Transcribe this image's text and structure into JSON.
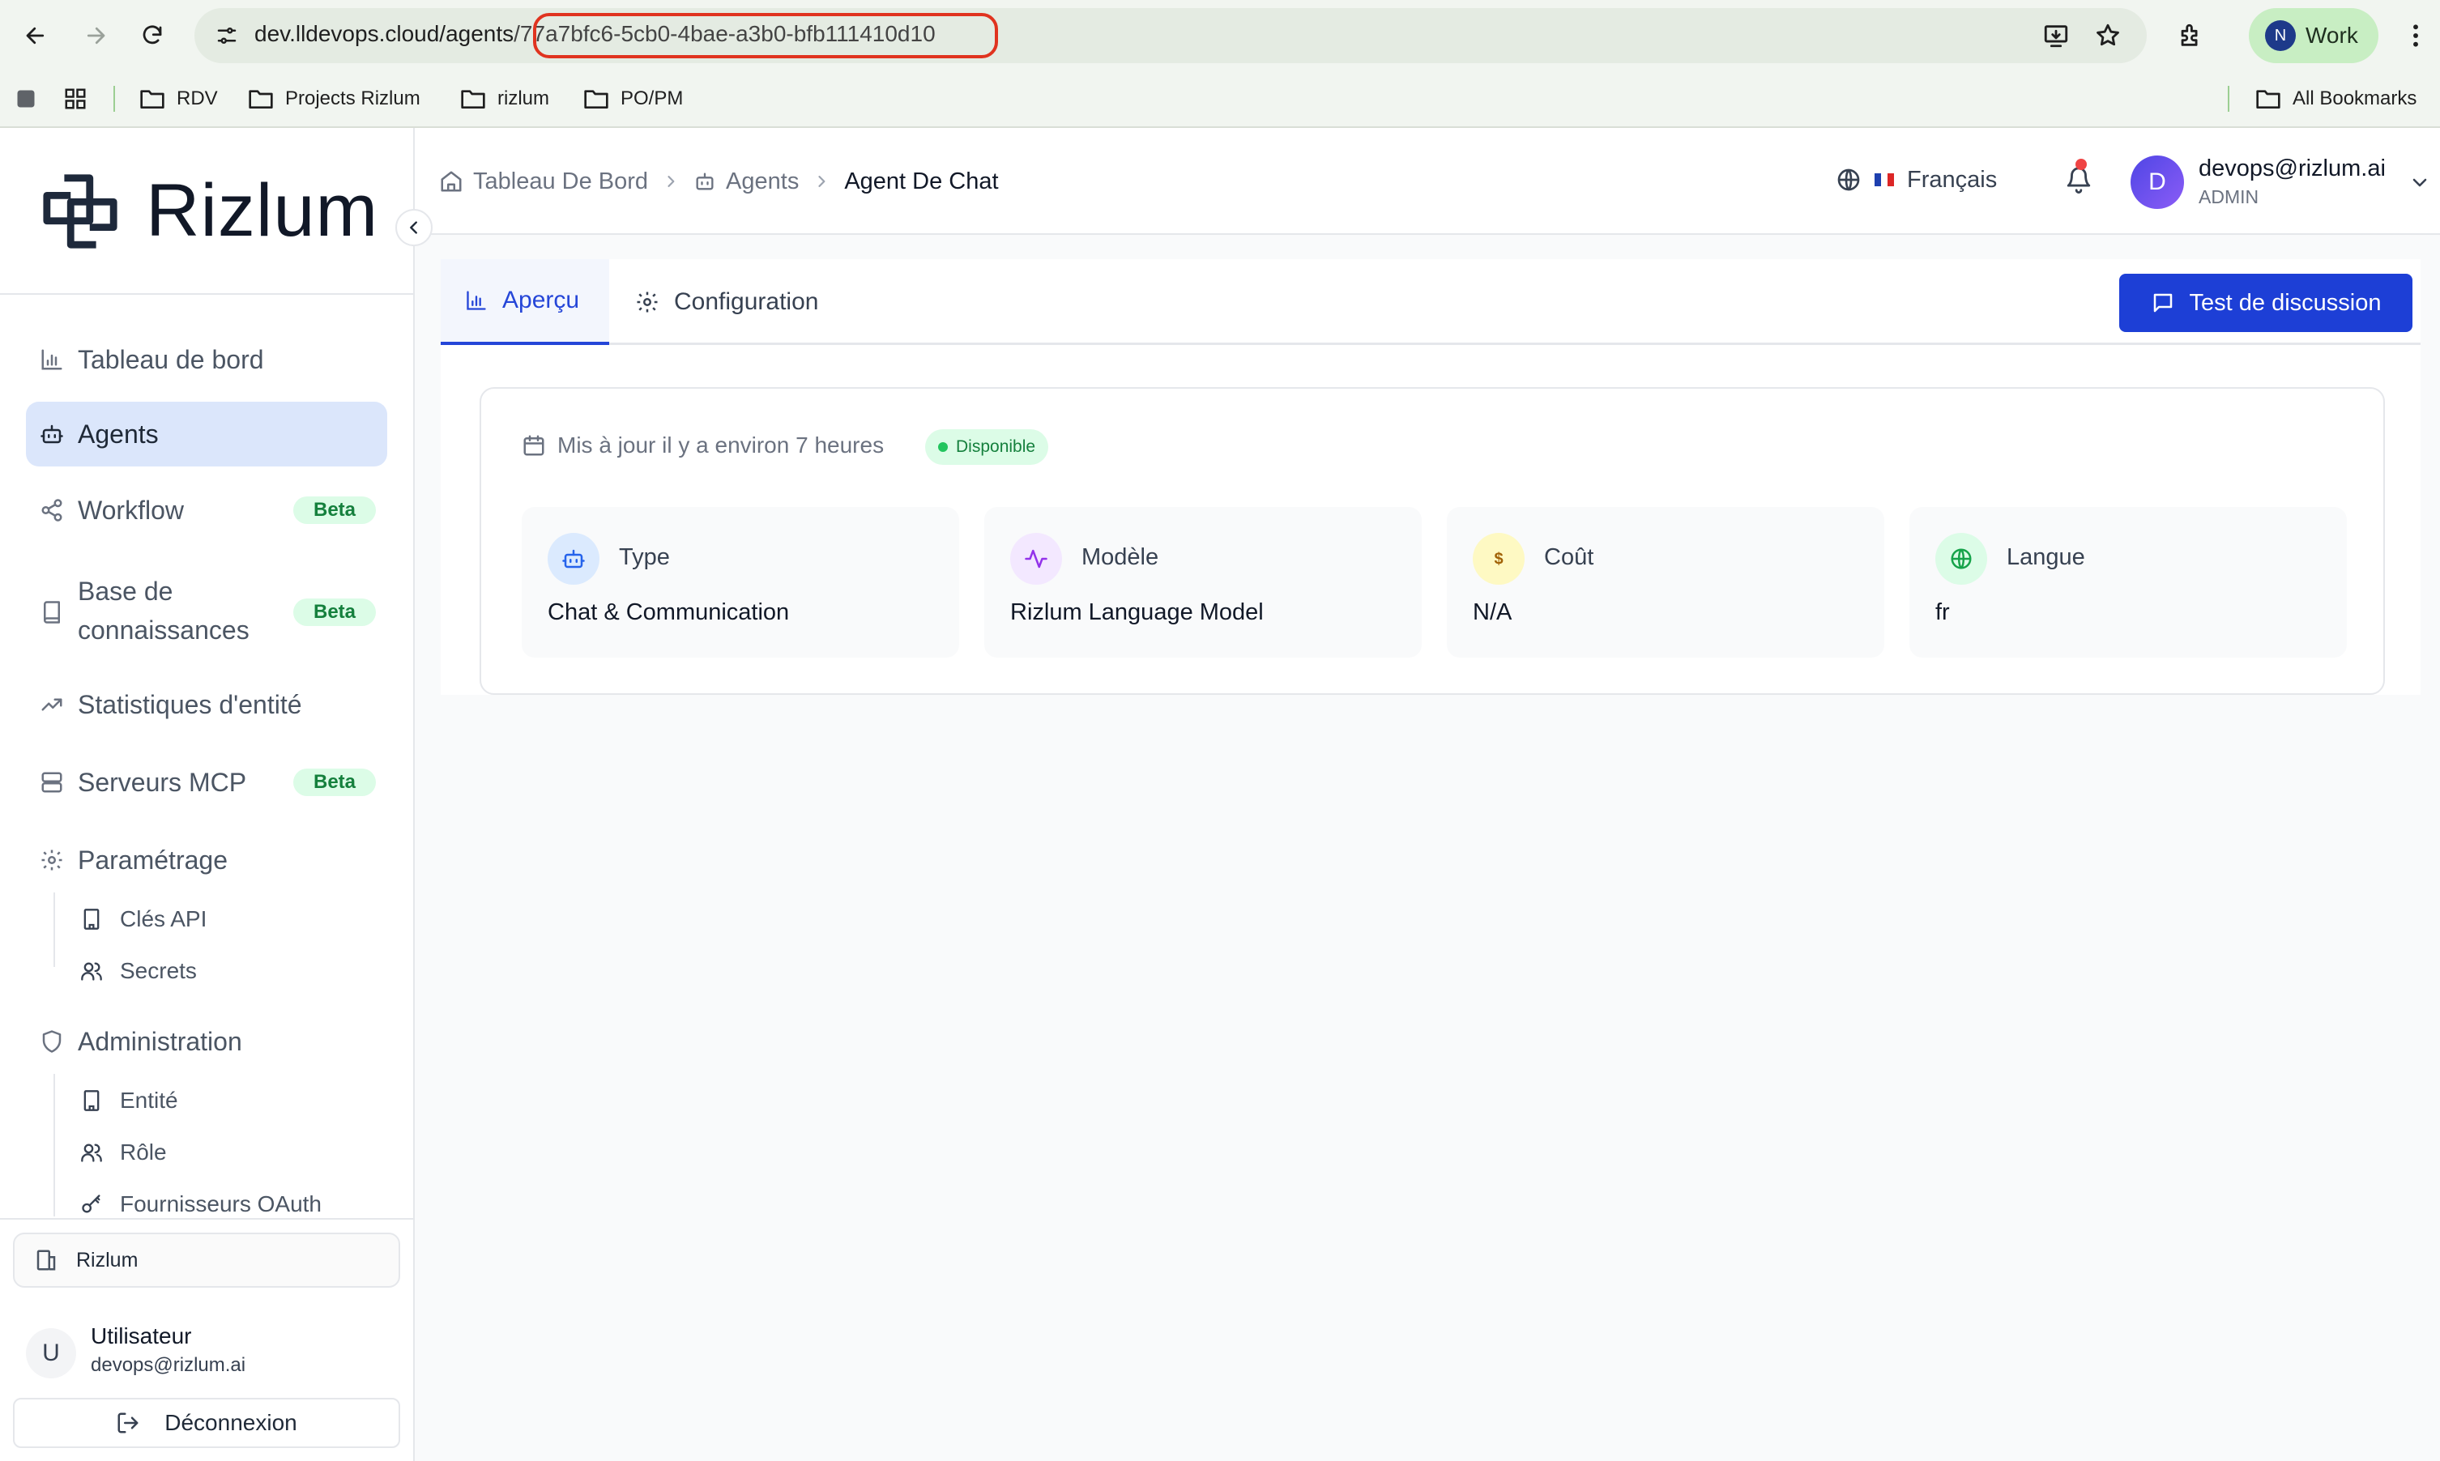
{
  "browser": {
    "url_host": "dev.lldevops.cloud/agents",
    "url_path": "/77a7bfc6-5cb0-4bae-a3b0-bfb111410d10",
    "profile_initial": "N",
    "profile_label": "Work",
    "bookmarks": [
      "RDV",
      "Projects Rizlum",
      "rizlum",
      "PO/PM"
    ],
    "all_bookmarks": "All Bookmarks"
  },
  "sidebar": {
    "brand": "Rizlum",
    "items": [
      {
        "label": "Tableau de bord",
        "icon": "bar-chart-icon"
      },
      {
        "label": "Agents",
        "icon": "bot-icon"
      },
      {
        "label": "Workflow",
        "icon": "share-icon",
        "badge": "Beta"
      },
      {
        "label_line1": "Base de",
        "label_line2": "connaissances",
        "icon": "book-icon",
        "badge": "Beta"
      },
      {
        "label": "Statistiques d'entité",
        "icon": "trending-up-icon"
      },
      {
        "label": "Serveurs MCP",
        "icon": "server-icon",
        "badge": "Beta"
      },
      {
        "label": "Paramétrage",
        "icon": "gear-icon"
      },
      {
        "label": "Administration",
        "icon": "shield-icon"
      }
    ],
    "settings_sub": [
      {
        "label": "Clés API",
        "icon": "building-icon"
      },
      {
        "label": "Secrets",
        "icon": "users-icon"
      }
    ],
    "admin_sub": [
      {
        "label": "Entité",
        "icon": "building-icon"
      },
      {
        "label": "Rôle",
        "icon": "users-icon"
      },
      {
        "label": "Fournisseurs OAuth",
        "icon": "key-icon"
      }
    ],
    "org": "Rizlum",
    "user": {
      "initial": "U",
      "name": "Utilisateur",
      "email": "devops@rizlum.ai"
    },
    "logout": "Déconnexion"
  },
  "header": {
    "breadcrumb": [
      "Tableau De Bord",
      "Agents",
      "Agent De Chat"
    ],
    "language": "Français",
    "account": {
      "initial": "D",
      "email": "devops@rizlum.ai",
      "role": "ADMIN"
    }
  },
  "main": {
    "tabs": [
      "Aperçu",
      "Configuration"
    ],
    "chat_button": "Test de discussion",
    "updated": "Mis à jour il y a environ 7 heures",
    "status": "Disponible",
    "stats": [
      {
        "title": "Type",
        "value": "Chat & Communication",
        "icon": "bot-icon",
        "color": "#dbeafe"
      },
      {
        "title": "Modèle",
        "value": "Rizlum Language Model",
        "icon": "activity-icon",
        "color": "#f3e8ff"
      },
      {
        "title": "Coût",
        "value": "N/A",
        "icon": "dollar-icon",
        "color": "#fef9c3"
      },
      {
        "title": "Langue",
        "value": "fr",
        "icon": "globe-icon",
        "color": "#dcfce7"
      }
    ]
  },
  "colors": {
    "accent": "#1d3fd6",
    "active_bg": "#dbe6fb",
    "badge_bg": "#dcfce7",
    "badge_text": "#15803d",
    "notification": "#ef4444"
  }
}
